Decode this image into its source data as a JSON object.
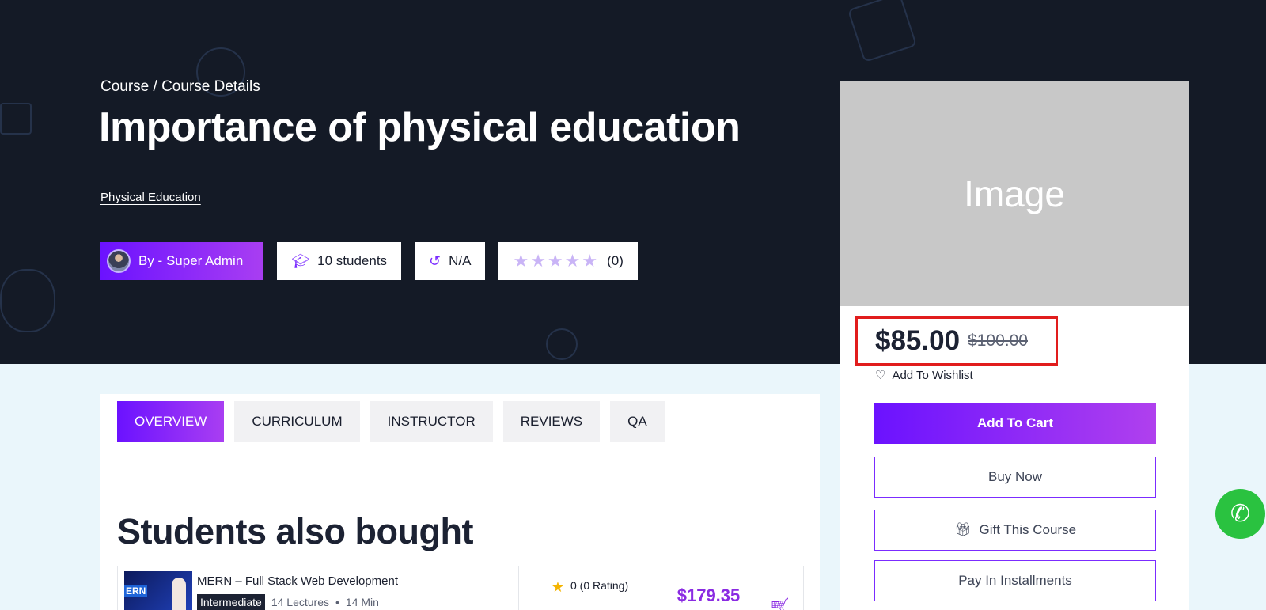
{
  "hero": {
    "breadcrumb": "Course / Course Details",
    "title": "Importance of physical education",
    "category": "Physical Education",
    "meta": {
      "author": "By - Super Admin",
      "students": "10 students",
      "duration": "N/A",
      "rating_count": "(0)",
      "stars": "★★★★★"
    }
  },
  "tabs": [
    {
      "label": "OVERVIEW",
      "active": true
    },
    {
      "label": "CURRICULUM"
    },
    {
      "label": "INSTRUCTOR"
    },
    {
      "label": "REVIEWS"
    },
    {
      "label": "QA"
    }
  ],
  "also_bought": {
    "title": "Students also bought",
    "items": [
      {
        "thumb_text": "ERN",
        "title": "MERN – Full Stack Web Development",
        "level": "Intermediate",
        "lectures": "14 Lectures",
        "duration": "14 Min",
        "rating": "0 (0 Rating)",
        "price": "$179.35"
      }
    ]
  },
  "sidebar": {
    "image_label": "Image",
    "price_current": "$85.00",
    "price_old": "$100.00",
    "wishlist": "Add To Wishlist",
    "add_to_cart": "Add To Cart",
    "buy_now": "Buy Now",
    "gift": "Gift This Course",
    "installments": "Pay In Installments"
  },
  "colors": {
    "hero_bg": "#141a26",
    "accent": "#7b2cff",
    "price_highlight": "#e11d1d",
    "whatsapp": "#2ac240"
  }
}
